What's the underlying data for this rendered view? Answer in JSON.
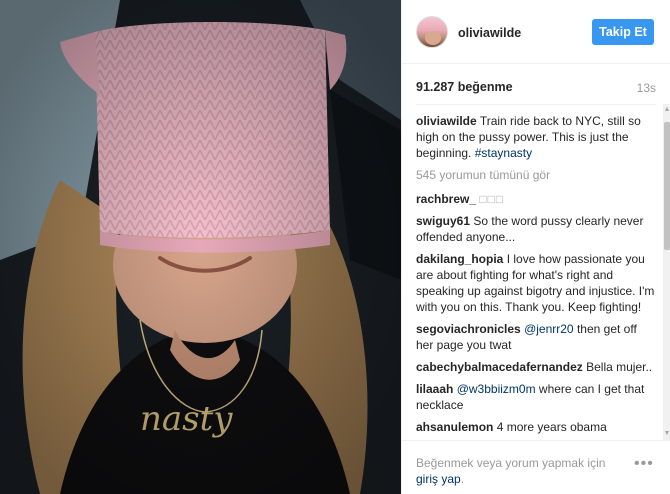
{
  "header": {
    "username": "oliviawilde",
    "follow_label": "Takip Et"
  },
  "stats": {
    "likes": "91.287 beğenme",
    "time": "13s"
  },
  "caption": {
    "user": "oliviawilde",
    "text": "Train ride back to NYC, still so high on the pussy power. This is just the beginning.",
    "hashtag": "#staynasty"
  },
  "view_all_comments": "545 yorumun tümünü gör",
  "comments": [
    {
      "user": "rachbrew_",
      "text": "□□□"
    },
    {
      "user": "swiguy61",
      "text": "So the word pussy clearly never offended anyone..."
    },
    {
      "user": "dakilang_hopia",
      "text": "I love how passionate you are about fighting for what's right and speaking up against bigotry and injustice. I'm with you on this. Thank you. Keep fighting!"
    },
    {
      "user": "segoviachronicles",
      "mention": "@jenrr20",
      "text": "then get off her page you twat"
    },
    {
      "user": "cabechybalmacedafernandez",
      "text": "Bella mujer.."
    },
    {
      "user": "lilaaah",
      "mention": "@w3bbiizm0m",
      "text": "where can I get that necklace"
    },
    {
      "user": "ahsanulemon",
      "text": "4 more years obama"
    }
  ],
  "footer": {
    "prompt": "Beğenmek veya yorum yapmak için",
    "login_label": "giriş yap",
    "login_suffix": ".",
    "more_icon": "•••"
  },
  "scrollbar": {
    "up": "▲",
    "down": "▼"
  },
  "photo": {
    "necklace_text": "nasty"
  },
  "colors": {
    "follow_button": "#3897f0",
    "link": "#003569",
    "hat": "#f2bccb"
  }
}
